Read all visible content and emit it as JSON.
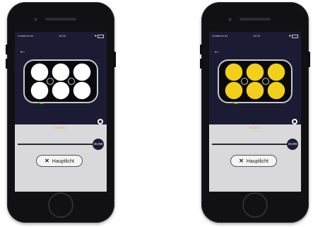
{
  "screens": [
    {
      "status": {
        "carrier": "Vodafone.de",
        "time": "18:25"
      },
      "stufe_label": "STUFE 1",
      "slider_value_label": "20,0W",
      "slider_value": 1.0,
      "light_button_label": "Hauptlicht",
      "led_color": "#ffffff"
    },
    {
      "status": {
        "carrier": "Vodafone.de",
        "time": "18:25"
      },
      "stufe_label": "STUFE 2",
      "slider_value_label": "20,0W",
      "slider_value": 1.0,
      "light_button_label": "Hauptlicht",
      "led_color": "#f2cf1c"
    }
  ],
  "icons": {
    "back": "arrow-left-icon",
    "close": "close-icon",
    "eye": "eye-icon"
  }
}
